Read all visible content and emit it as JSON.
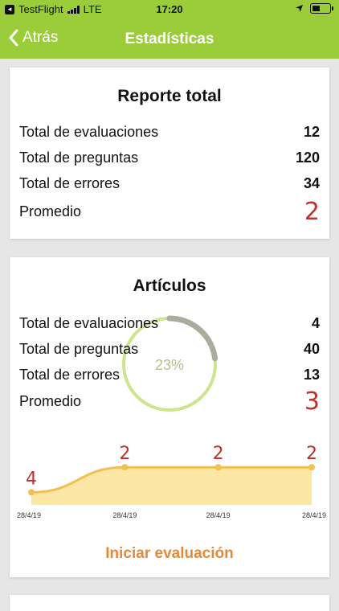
{
  "status_bar": {
    "carrier": "TestFlight",
    "network": "LTE",
    "time": "17:20"
  },
  "nav": {
    "back_label": "Atrás",
    "title": "Estadísticas"
  },
  "report_total": {
    "title": "Reporte total",
    "rows": [
      {
        "label": "Total de evaluaciones",
        "value": "12"
      },
      {
        "label": "Total de preguntas",
        "value": "120"
      },
      {
        "label": "Total de errores",
        "value": "34"
      },
      {
        "label": "Promedio",
        "value": "2"
      }
    ]
  },
  "articulos": {
    "title": "Artículos",
    "rows": [
      {
        "label": "Total de evaluaciones",
        "value": "4"
      },
      {
        "label": "Total de preguntas",
        "value": "40"
      },
      {
        "label": "Total de errores",
        "value": "13"
      },
      {
        "label": "Promedio",
        "value": "3"
      }
    ],
    "progress_text": "23%",
    "progress_fraction": 0.23,
    "start_button": "Iniciar evaluación"
  },
  "colors": {
    "header": "#9bcd3a",
    "accent_orange": "#e38a3a",
    "score_red": "#c0302c",
    "chart_line": "#f1c04e",
    "chart_fill": "#fbe6a6",
    "ring": "#cde58e"
  },
  "chart_data": {
    "type": "area",
    "x": [
      "28/4/19",
      "28/4/19",
      "28/4/19",
      "28/4/19"
    ],
    "values": [
      4,
      2,
      2,
      2
    ],
    "data_labels": [
      "4",
      "2",
      "2",
      "2"
    ],
    "ylim": [
      0,
      5
    ],
    "inverted_y": true,
    "grid": false
  }
}
